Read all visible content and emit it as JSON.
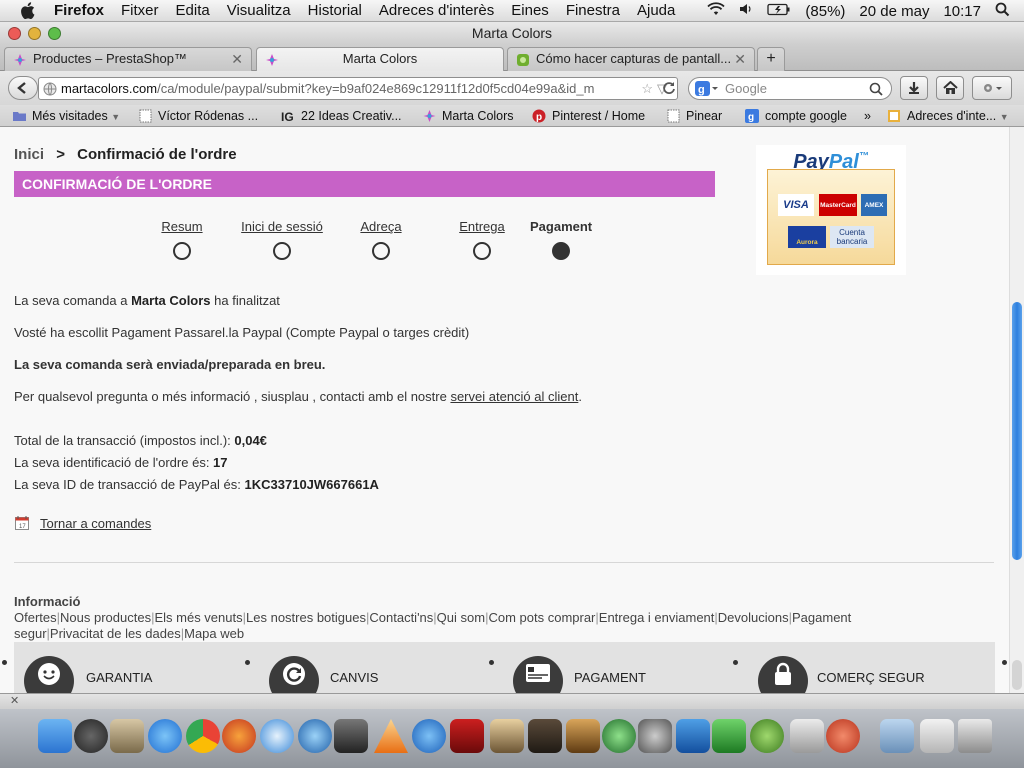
{
  "menubar": {
    "app": "Firefox",
    "items": [
      "Fitxer",
      "Edita",
      "Visualitza",
      "Historial",
      "Adreces d'interès",
      "Eines",
      "Finestra",
      "Ajuda"
    ],
    "battery": "(85%)",
    "date": "20 de may",
    "time": "10:17"
  },
  "window": {
    "title": "Marta Colors"
  },
  "tabs": [
    {
      "label": "Productes – PrestaShop™",
      "active": false
    },
    {
      "label": "Marta Colors",
      "active": true
    },
    {
      "label": "Cómo hacer capturas de pantall...",
      "active": false
    }
  ],
  "nav": {
    "url_host": "martacolors.com",
    "url_path": "/ca/module/paypal/submit?key=b9af024e869c12911f12d0f5cd04e99a&id_m",
    "search_placeholder": "Google"
  },
  "bookmarks": [
    {
      "label": "Més visitades",
      "icon": "folder-icon"
    },
    {
      "label": "Víctor Ródenas ...",
      "icon": "page-icon"
    },
    {
      "label": "22 Ideas Creativ...",
      "icon": "ig-icon"
    },
    {
      "label": "Marta Colors",
      "icon": "marta-icon"
    },
    {
      "label": "Pinterest / Home",
      "icon": "pinterest-icon"
    },
    {
      "label": "Pinear",
      "icon": "page-icon"
    },
    {
      "label": "compte google",
      "icon": "google-icon"
    },
    {
      "label": "Adreces d'inte...",
      "icon": "bookmarks-icon"
    }
  ],
  "page": {
    "breadcrumb": {
      "home": "Inici",
      "separator": ">",
      "current": "Confirmació de l'ordre"
    },
    "heading": "CONFIRMACIÓ DE L'ORDRE",
    "steps": [
      {
        "label": "Resum",
        "current": false
      },
      {
        "label": "Inici de sessió",
        "current": false
      },
      {
        "label": "Adreça",
        "current": false
      },
      {
        "label": "Entrega",
        "current": false
      },
      {
        "label": "Pagament",
        "current": true
      }
    ],
    "paypal": {
      "brand_a": "Pay",
      "brand_b": "Pal",
      "tm": "™",
      "cards": [
        "VISA",
        "MasterCard",
        "AMEX"
      ],
      "aurora": "Aurora",
      "bank_line1": "Cuenta",
      "bank_line2": "bancaria"
    },
    "msg_order_pre": "La seva comanda a ",
    "msg_order_shop": "Marta Colors",
    "msg_order_post": " ha finalitzat",
    "msg_payment": "Vosté ha escollit Pagament Passarel.la Paypal (Compte Paypal o targes crèdit)",
    "msg_shipping": "La seva comanda serà enviada/preparada en breu.",
    "msg_contact_pre": "Per qualsevol pregunta o més informació , siusplau , contacti amb el nostre ",
    "msg_contact_link": "servei atenció al client",
    "msg_contact_post": ".",
    "total_label": "Total de la transacció (impostos incl.): ",
    "total_value": "0,04€",
    "order_id_label": "La seva identificació de l'ordre és: ",
    "order_id_value": "17",
    "paypal_id_label": "La seva ID de transacció de PayPal és: ",
    "paypal_id_value": "1KC33710JW667661A",
    "back_link": "Tornar a comandes",
    "footer_title": "Informació",
    "footer_links": [
      "Ofertes",
      "Nous productes",
      "Els més venuts",
      "Les nostres botigues",
      "Contacti'ns",
      "Qui som",
      "Com pots comprar",
      "Entrega i enviament",
      "Devolucions",
      "Pagament segur",
      "Privacitat de les dades",
      "Mapa web"
    ],
    "features": [
      {
        "label": "GARANTIA",
        "icon": "smiley-icon"
      },
      {
        "label": "CANVIS",
        "icon": "exchange-icon"
      },
      {
        "label": "PAGAMENT",
        "icon": "card-icon"
      },
      {
        "label": "COMERÇ SEGUR",
        "icon": "lock-icon"
      }
    ]
  },
  "colors": {
    "heading_bg": "#c762c7",
    "paypal_dark": "#1a3b7a",
    "paypal_light": "#2f8fd8",
    "scroll_thumb": "#2c7fdf"
  }
}
